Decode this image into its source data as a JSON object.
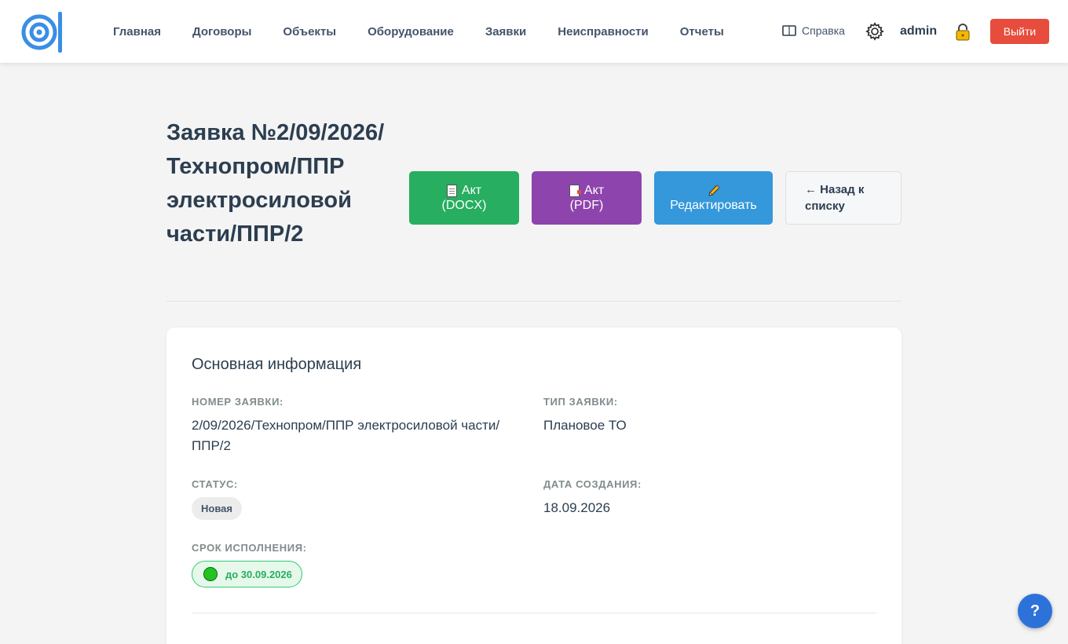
{
  "header": {
    "nav": [
      "Главная",
      "Договоры",
      "Объекты",
      "Оборудование",
      "Заявки",
      "Неисправности",
      "Отчеты"
    ],
    "help_label": "Справка",
    "username": "admin",
    "logout_label": "Выйти"
  },
  "page": {
    "title": "Заявка №2/09/2026/ Технопром/ППР электросиловой части/ППР/2",
    "buttons": {
      "act_docx_line1": "Акт",
      "act_docx_line2": "(DOCX)",
      "act_pdf_line1": "Акт",
      "act_pdf_line2": "(PDF)",
      "edit": "Редактировать",
      "back_line1": "← Назад к",
      "back_line2": "списку"
    }
  },
  "info": {
    "section_title": "Основная информация",
    "number_label": "НОМЕР ЗАЯВКИ:",
    "number_line1": "2/09/2026/Технопром/ППР электросиловой части/",
    "number_line2": "ППР/2",
    "type_label": "ТИП ЗАЯВКИ:",
    "type_value": "Плановое ТО",
    "status_label": "СТАТУС:",
    "status_value": "Новая",
    "created_label": "ДАТА СОЗДАНИЯ:",
    "created_value": "18.09.2026",
    "deadline_label": "СРОК ИСПОЛНЕНИЯ:",
    "deadline_value": "до 30.09.2026"
  },
  "colors": {
    "brand": "#3a8ee6",
    "docx": "#27ae60",
    "pdf": "#8e44ad",
    "edit": "#3498db",
    "logout": "#e74c3c",
    "deadline_ok": "#22c322"
  },
  "icons": {
    "logo": "logo-icon",
    "help": "book-icon",
    "settings": "gear-icon",
    "lock": "lock-icon",
    "docx": "document-icon",
    "pdf": "pdf-document-icon",
    "edit": "pencil-icon",
    "fab": "question-icon"
  },
  "fab_label": "?"
}
